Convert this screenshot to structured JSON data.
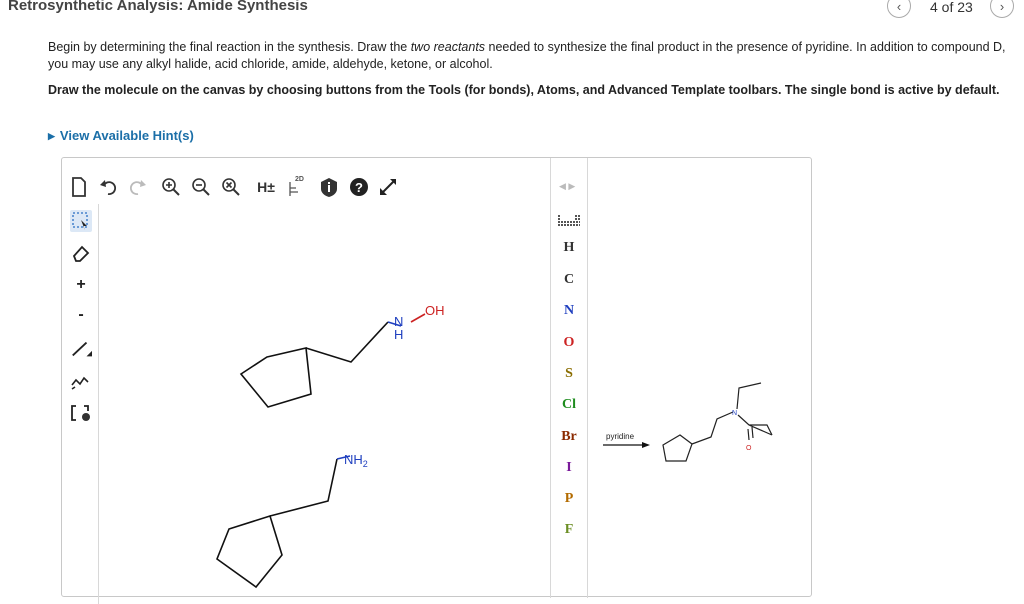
{
  "page": {
    "title": "Retrosynthetic Analysis: Amide Synthesis",
    "page_count": "4 of 23",
    "prev_icon": "chevron-left-icon",
    "next_icon": "chevron-right-icon"
  },
  "instructions": {
    "line1": "Begin by determining the final reaction in the synthesis. Draw the ",
    "line1_em": "two reactants",
    "line1_rest": " needed to synthesize the final product in the presence of pyridine. In addition to compound D, you may use any alkyl halide, acid chloride, amide, aldehyde, ketone, or alcohol.",
    "line2": "Draw the molecule on the canvas by choosing buttons from the Tools (for bonds), Atoms, and Advanced Template toolbars. The single bond is active by default.",
    "hint": "View Available Hint(s)"
  },
  "toolbar": {
    "h_toggle": "H±",
    "label_2d": "2D",
    "icons": [
      "new-document-icon",
      "undo-icon",
      "redo-icon",
      "zoom-in-icon",
      "zoom-out-icon",
      "clear-icon",
      "h-toggle-icon",
      "2d-clean-icon",
      "info-icon",
      "help-icon",
      "fullscreen-icon"
    ]
  },
  "left_tools": {
    "plus": "+",
    "minus": "-"
  },
  "atoms": [
    "H",
    "C",
    "N",
    "O",
    "S",
    "Cl",
    "Br",
    "I",
    "P",
    "F"
  ],
  "atom_colors": {
    "H": "#333333",
    "C": "#333333",
    "N": "#1f3fbf",
    "O": "#cc2222",
    "S": "#8a6d00",
    "Cl": "#1e8c1e",
    "Br": "#8b2a00",
    "I": "#7a1b9a",
    "P": "#b36b00",
    "F": "#6b8e23"
  },
  "canvas": {
    "mol1": {
      "n_label": "N",
      "h_label": "H",
      "oh_label": "OH"
    },
    "mol2": {
      "nh2_label": "NH",
      "nh2_sub": "2"
    }
  },
  "reaction": {
    "reagent": "pyridine",
    "n_label": "N",
    "o_label": "O"
  }
}
